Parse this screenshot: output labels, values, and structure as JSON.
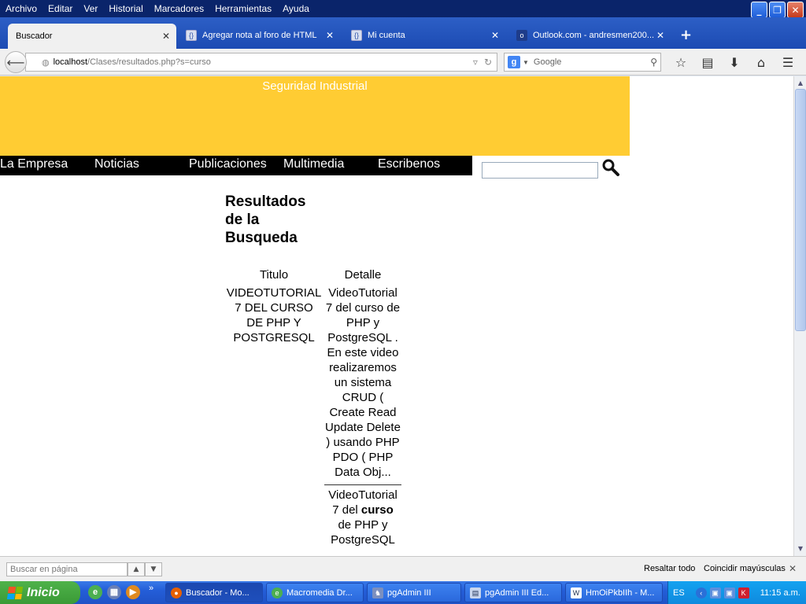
{
  "menubar": {
    "items": [
      "Archivo",
      "Editar",
      "Ver",
      "Historial",
      "Marcadores",
      "Herramientas",
      "Ayuda"
    ]
  },
  "tabs": [
    {
      "label": "Buscador",
      "active": true
    },
    {
      "label": "Agregar nota al foro de HTML",
      "active": false
    },
    {
      "label": "Mi cuenta",
      "active": false
    },
    {
      "label": "Outlook.com - andresmen200...",
      "active": false
    }
  ],
  "navbar": {
    "url_host": "localhost",
    "url_path": "/Clases/resultados.php?s=curso",
    "search_placeholder": "Google"
  },
  "site": {
    "title": "Seguridad Industrial",
    "nav": [
      "La Empresa",
      "Noticias",
      "Publicaciones",
      "Multimedia",
      "Escribenos"
    ],
    "search_value": ""
  },
  "results": {
    "heading": "Resultados de la Busqueda",
    "columns": [
      "Titulo",
      "Detalle"
    ],
    "rows": [
      {
        "title": "VIDEOTUTORIAL 7 DEL CURSO DE PHP Y POSTGRESQL",
        "detail": "VideoTutorial 7 del curso de PHP y PostgreSQL . En este video realizaremos un sistema CRUD ( Create Read Update Delete ) usando PHP PDO ( PHP Data Obj..."
      }
    ],
    "second_detail_before": "VideoTutorial 7 del ",
    "second_detail_keyword": "curso",
    "second_detail_after": " de PHP y PostgreSQL"
  },
  "findbar": {
    "placeholder": "Buscar en página",
    "highlight_all": "Resaltar todo",
    "match_case": "Coincidir mayúsculas"
  },
  "taskbar": {
    "start_label": "Inicio",
    "tasks": [
      "Buscador - Mo...",
      "Macromedia Dr...",
      "pgAdmin III",
      "pgAdmin III Ed...",
      "HmOiPkbIIh - M..."
    ],
    "lang": "ES",
    "clock": "11:15 a.m."
  },
  "colors": {
    "header_yellow": "#ffcc33",
    "nav_black": "#000000",
    "title_bar": "#0a246a"
  }
}
